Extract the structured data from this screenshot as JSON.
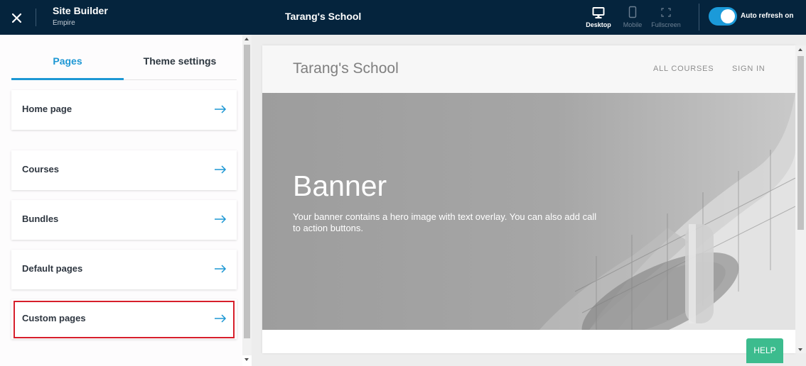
{
  "topbar": {
    "app_title": "Site Builder",
    "app_subtitle": "Empire",
    "site_title": "Tarang's School",
    "views": {
      "desktop": "Desktop",
      "mobile": "Mobile",
      "fullscreen": "Fullscreen",
      "selected": "Desktop"
    },
    "auto_refresh_label": "Auto refresh on",
    "auto_refresh_on": true
  },
  "left_panel": {
    "tabs": [
      {
        "label": "Pages",
        "active": true
      },
      {
        "label": "Theme settings",
        "active": false
      }
    ],
    "pages": [
      {
        "label": "Home page"
      },
      {
        "label": "Courses"
      },
      {
        "label": "Bundles"
      },
      {
        "label": "Default pages"
      },
      {
        "label": "Custom pages",
        "highlighted": true
      }
    ]
  },
  "preview": {
    "school_name": "Tarang's School",
    "nav": [
      "ALL COURSES",
      "SIGN IN"
    ],
    "banner_title": "Banner",
    "banner_text": "Your banner contains a hero image with text overlay. You can also add call to action buttons."
  },
  "help_label": "HELP",
  "colors": {
    "topbar_bg": "#05243d",
    "accent": "#1d97d4",
    "toggle": "#1b9ad9",
    "highlight": "#d71f2b",
    "help": "#3cbc8e"
  },
  "icons": {
    "close": "close-icon",
    "desktop": "monitor-icon",
    "mobile": "phone-icon",
    "fullscreen": "fullscreen-icon",
    "arrow": "arrow-right-icon"
  }
}
